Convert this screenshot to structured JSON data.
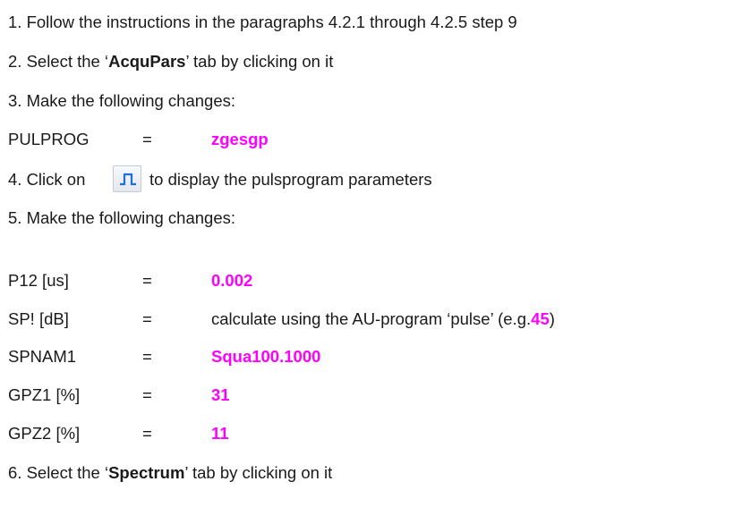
{
  "steps": {
    "s1": "1. Follow the instructions in the paragraphs 4.2.1 through 4.2.5 step 9",
    "s2_pre": "2. Select the ‘",
    "s2_bold": "AcquPars",
    "s2_post": "’ tab by clicking on it",
    "s3": "3. Make the following changes:",
    "s4_pre": "4. Click on",
    "s4_post": "to display the pulsprogram parameters",
    "s5": "5. Make the following changes:",
    "s6_pre": "6. Select the ‘",
    "s6_bold": "Spectrum",
    "s6_post": "’ tab by clicking on it"
  },
  "pulprog": {
    "name": "PULPROG",
    "eq": "=",
    "value": "zgesgp"
  },
  "params": {
    "p12": {
      "name": "P12 [us]",
      "eq": "=",
      "value": "0.002"
    },
    "sp": {
      "name": "SP! [dB]",
      "eq": "=",
      "value_pre": "calculate using the AU-program ‘pulse’ (e.g.",
      "value_hl": "45",
      "value_post": ")"
    },
    "spnam1": {
      "name": "SPNAM1",
      "eq": "=",
      "value": "Squa100.1000"
    },
    "gpz1": {
      "name": "GPZ1 [%]",
      "eq": "=",
      "value": "31"
    },
    "gpz2": {
      "name": "GPZ2 [%]",
      "eq": "=",
      "value": "11"
    }
  },
  "icons": {
    "pulse_button": "pulse-program-icon"
  },
  "colors": {
    "highlight": "#ff00ff",
    "icon": "#1e6fd9"
  }
}
